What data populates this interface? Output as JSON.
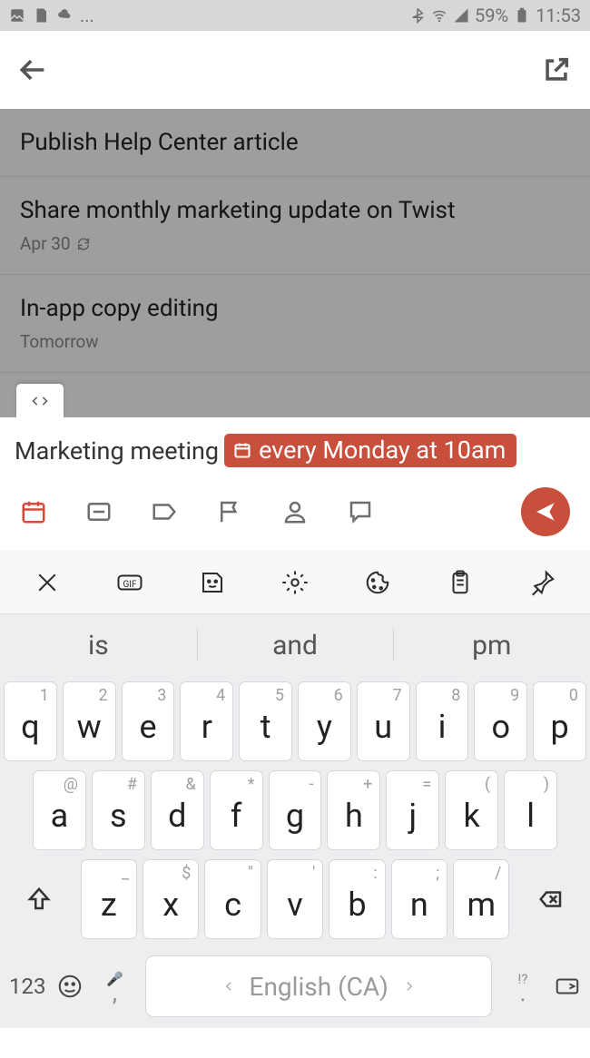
{
  "status": {
    "ellipsis": "...",
    "battery": "59%",
    "time": "11:53"
  },
  "tasks": [
    {
      "title": "Publish Help Center article",
      "meta": ""
    },
    {
      "title": "Share monthly marketing update on Twist",
      "meta": "Apr 30",
      "recurring": true
    },
    {
      "title": "In-app copy editing",
      "meta": "Tomorrow"
    }
  ],
  "compose": {
    "text": "Marketing meeting",
    "chip": "every Monday at 10am"
  },
  "keyboard": {
    "suggestions": [
      "is",
      "and",
      "pm"
    ],
    "row1": [
      {
        "m": "q",
        "a": "1"
      },
      {
        "m": "w",
        "a": "2"
      },
      {
        "m": "e",
        "a": "3"
      },
      {
        "m": "r",
        "a": "4"
      },
      {
        "m": "t",
        "a": "5"
      },
      {
        "m": "y",
        "a": "6"
      },
      {
        "m": "u",
        "a": "7"
      },
      {
        "m": "i",
        "a": "8"
      },
      {
        "m": "o",
        "a": "9"
      },
      {
        "m": "p",
        "a": "0"
      }
    ],
    "row2": [
      {
        "m": "a",
        "a": "@"
      },
      {
        "m": "s",
        "a": "#"
      },
      {
        "m": "d",
        "a": "&"
      },
      {
        "m": "f",
        "a": "*"
      },
      {
        "m": "g",
        "a": "-"
      },
      {
        "m": "h",
        "a": "+"
      },
      {
        "m": "j",
        "a": "="
      },
      {
        "m": "k",
        "a": "("
      },
      {
        "m": "l",
        "a": ")"
      }
    ],
    "row3": [
      {
        "m": "z",
        "a": "_"
      },
      {
        "m": "x",
        "a": "$"
      },
      {
        "m": "c",
        "a": "\""
      },
      {
        "m": "v",
        "a": "'"
      },
      {
        "m": "b",
        "a": ":"
      },
      {
        "m": "n",
        "a": ";"
      },
      {
        "m": "m",
        "a": "/"
      }
    ],
    "numKey": "123",
    "language": "English (CA)",
    "commaSup": "🎤",
    "dotSup": "!?"
  }
}
